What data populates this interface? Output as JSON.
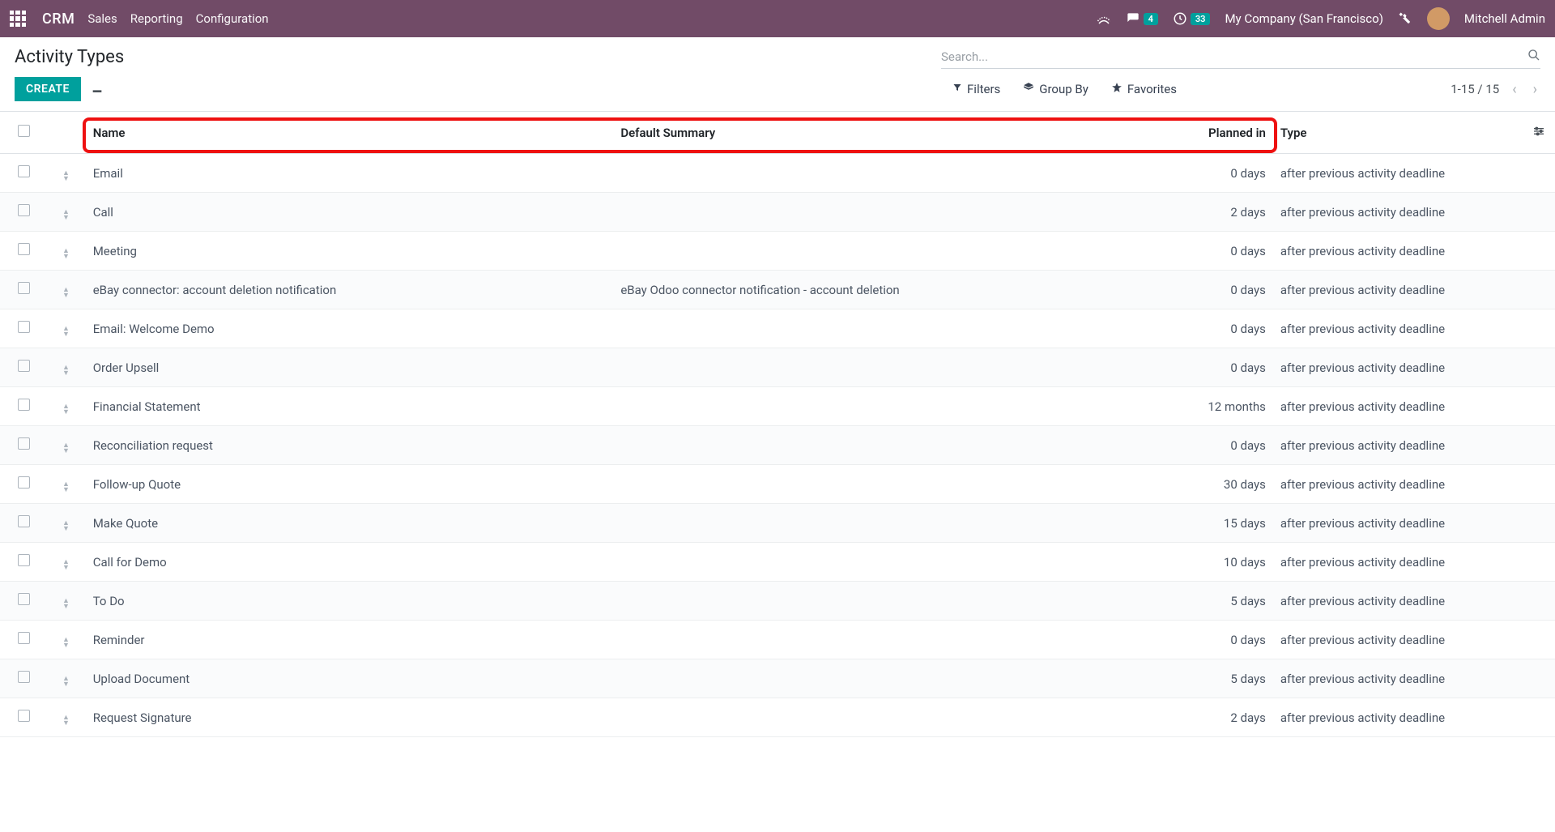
{
  "nav": {
    "brand": "CRM",
    "links": [
      "Sales",
      "Reporting",
      "Configuration"
    ],
    "msg_badge": "4",
    "clock_badge": "33",
    "company": "My Company (San Francisco)",
    "user": "Mitchell Admin"
  },
  "cp": {
    "title": "Activity Types",
    "create": "CREATE",
    "search_placeholder": "Search...",
    "filters": "Filters",
    "group_by": "Group By",
    "favorites": "Favorites",
    "pager": "1-15 / 15"
  },
  "columns": {
    "name": "Name",
    "summary": "Default Summary",
    "planned": "Planned in",
    "type": "Type"
  },
  "rows": [
    {
      "name": "Email",
      "summary": "",
      "planned": "0 days",
      "type": "after previous activity deadline"
    },
    {
      "name": "Call",
      "summary": "",
      "planned": "2 days",
      "type": "after previous activity deadline"
    },
    {
      "name": "Meeting",
      "summary": "",
      "planned": "0 days",
      "type": "after previous activity deadline"
    },
    {
      "name": "eBay connector: account deletion notification",
      "summary": "eBay Odoo connector notification - account deletion",
      "planned": "0 days",
      "type": "after previous activity deadline"
    },
    {
      "name": "Email: Welcome Demo",
      "summary": "",
      "planned": "0 days",
      "type": "after previous activity deadline"
    },
    {
      "name": "Order Upsell",
      "summary": "",
      "planned": "0 days",
      "type": "after previous activity deadline"
    },
    {
      "name": "Financial Statement",
      "summary": "",
      "planned": "12 months",
      "type": "after previous activity deadline"
    },
    {
      "name": "Reconciliation request",
      "summary": "",
      "planned": "0 days",
      "type": "after previous activity deadline"
    },
    {
      "name": "Follow-up Quote",
      "summary": "",
      "planned": "30 days",
      "type": "after previous activity deadline"
    },
    {
      "name": "Make Quote",
      "summary": "",
      "planned": "15 days",
      "type": "after previous activity deadline"
    },
    {
      "name": "Call for Demo",
      "summary": "",
      "planned": "10 days",
      "type": "after previous activity deadline"
    },
    {
      "name": "To Do",
      "summary": "",
      "planned": "5 days",
      "type": "after previous activity deadline"
    },
    {
      "name": "Reminder",
      "summary": "",
      "planned": "0 days",
      "type": "after previous activity deadline"
    },
    {
      "name": "Upload Document",
      "summary": "",
      "planned": "5 days",
      "type": "after previous activity deadline"
    },
    {
      "name": "Request Signature",
      "summary": "",
      "planned": "2 days",
      "type": "after previous activity deadline"
    }
  ]
}
